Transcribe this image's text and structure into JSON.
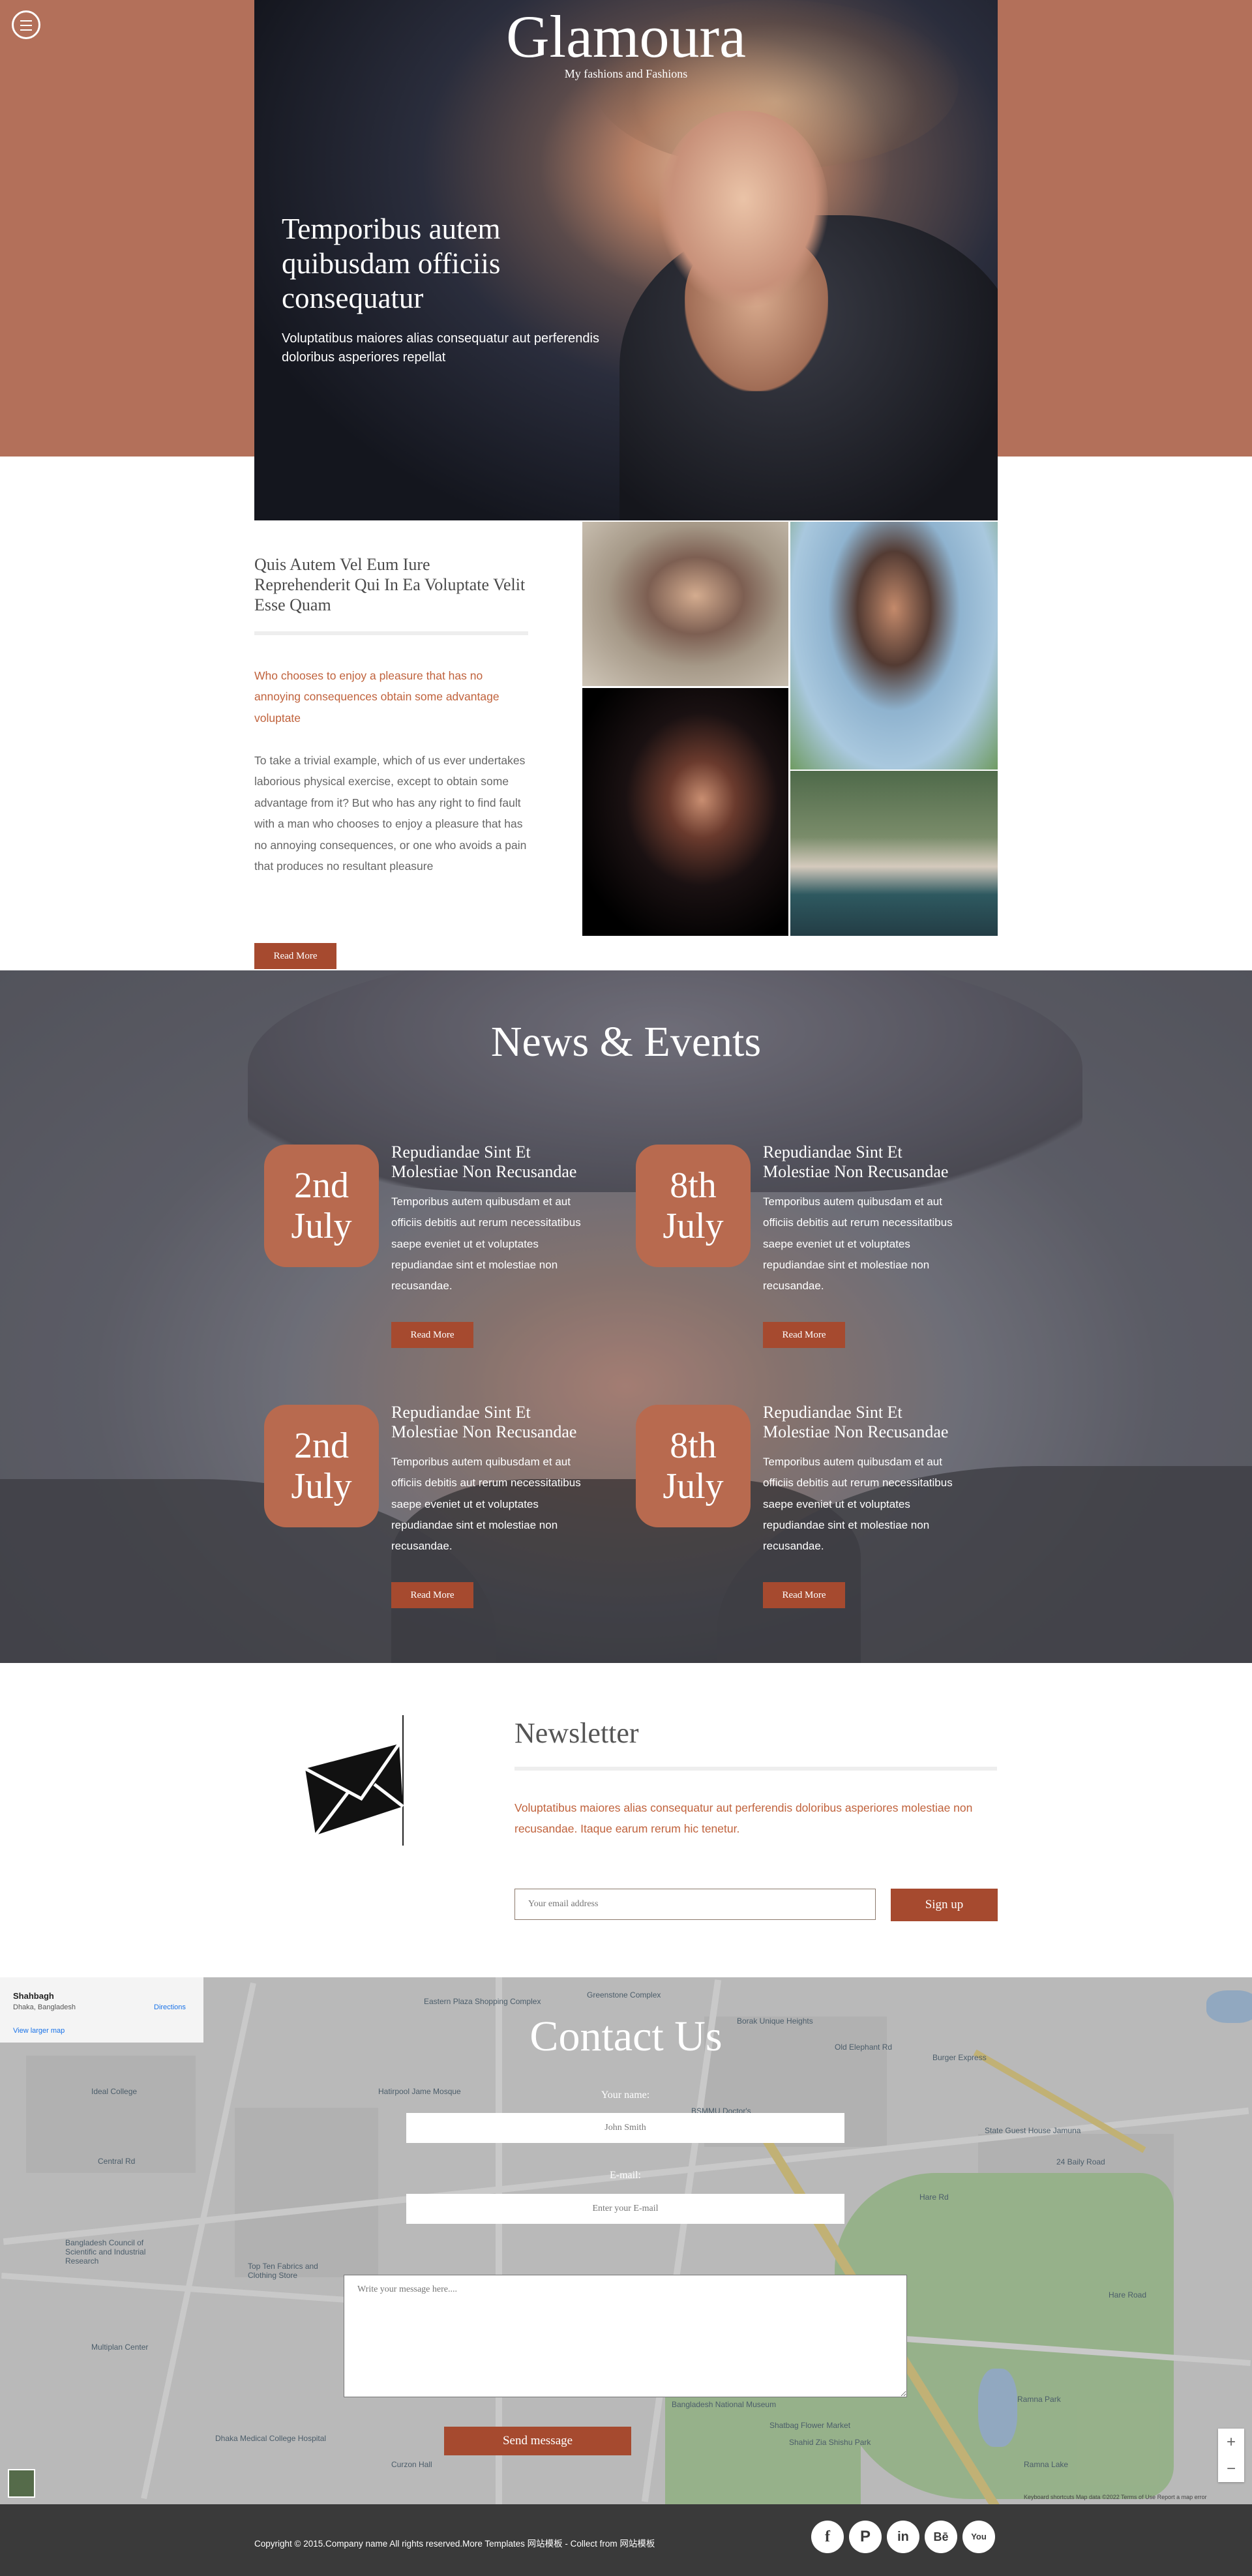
{
  "header": {
    "site_title": "Glamoura",
    "tagline": "My fashions and Fashions",
    "menu_icon": "menu-icon"
  },
  "hero": {
    "heading": "Temporibus autem quibusdam officiis consequatur",
    "text": "Voluptatibus maiores alias consequatur aut perferendis doloribus asperiores repellat"
  },
  "intro": {
    "title": "Quis Autem Vel Eum Iure Reprehenderit Qui In Ea Voluptate Velit Esse Quam",
    "accent": "Who chooses to enjoy a pleasure that has no annoying consequences obtain some advantage voluptate",
    "body": "To take a trivial example, which of us ever undertakes laborious physical exercise, except to obtain some advantage from it? But who has any right to find fault with a man who chooses to enjoy a pleasure that has no annoying consequences, or one who avoids a pain that produces no resultant pleasure",
    "read_more": "Read More"
  },
  "news": {
    "title": "News & Events",
    "events": [
      {
        "day": "2nd",
        "month": "July",
        "title": "Repudiandae Sint Et Molestiae Non Recusandae",
        "text": "Temporibus autem quibusdam et aut officiis debitis aut rerum necessitatibus saepe eveniet ut et voluptates repudiandae sint et molestiae non recusandae.",
        "read_more": "Read More"
      },
      {
        "day": "8th",
        "month": "July",
        "title": "Repudiandae Sint Et Molestiae Non Recusandae",
        "text": "Temporibus autem quibusdam et aut officiis debitis aut rerum necessitatibus saepe eveniet ut et voluptates repudiandae sint et molestiae non recusandae.",
        "read_more": "Read More"
      },
      {
        "day": "2nd",
        "month": "July",
        "title": "Repudiandae Sint Et Molestiae Non Recusandae",
        "text": "Temporibus autem quibusdam et aut officiis debitis aut rerum necessitatibus saepe eveniet ut et voluptates repudiandae sint et molestiae non recusandae.",
        "read_more": "Read More"
      },
      {
        "day": "8th",
        "month": "July",
        "title": "Repudiandae Sint Et Molestiae Non Recusandae",
        "text": "Temporibus autem quibusdam et aut officiis debitis aut rerum necessitatibus saepe eveniet ut et voluptates repudiandae sint et molestiae non recusandae.",
        "read_more": "Read More"
      }
    ]
  },
  "newsletter": {
    "title": "Newsletter",
    "text": "Voluptatibus maiores alias consequatur aut perferendis doloribus asperiores molestiae non recusandae. Itaque earum rerum hic tenetur.",
    "email_placeholder": "Your email address",
    "signup_label": "Sign up",
    "icon": "envelope-icon"
  },
  "map": {
    "place_name": "Shahbagh",
    "place_address": "Dhaka, Bangladesh",
    "directions_label": "Directions",
    "larger_map_link": "View larger map",
    "zoom_in": "+",
    "zoom_out": "−",
    "attribution": "Keyboard shortcuts   Map data ©2022   Terms of Use   Report a map error",
    "labels": [
      "Eastern Plaza Shopping Complex",
      "Greenstone Complex",
      "Borak Unique Heights",
      "Old Elephant Rd",
      "Burger Express",
      "Hatirpool Jame Mosque",
      "BSMMU Doctor's",
      "Ideal College",
      "Central Rd",
      "State Guest House Jamuna",
      "24 Baily Road",
      "Hare Rd",
      "Bangladesh Council of Scientific and Industrial Research",
      "Top Ten Fabrics and Clothing Store",
      "Multiplan Center",
      "Dhaka Medical College Hospital",
      "Ramna Park",
      "Shahid Zia Shishu Park",
      "Bangladesh National Museum",
      "Shatbag Flower Market",
      "Hare Road",
      "Ramna Lake",
      "Curzon Hall"
    ]
  },
  "contact": {
    "title": "Contact Us",
    "name_label": "Your name:",
    "name_value": "John Smith",
    "email_label": "E-mail:",
    "email_placeholder": "Enter your E-mail",
    "message_placeholder": "Write your message here....",
    "send_label": "Send message"
  },
  "footer": {
    "copyright": "Copyright © 2015.Company name All rights reserved.More Templates 网站模板 - Collect from 网站模板",
    "social": [
      {
        "name": "facebook-icon",
        "glyph": "f"
      },
      {
        "name": "pinterest-icon",
        "glyph": "P"
      },
      {
        "name": "linkedin-icon",
        "glyph": "in"
      },
      {
        "name": "behance-icon",
        "glyph": "Bē"
      },
      {
        "name": "youtube-icon",
        "glyph": "You"
      }
    ]
  },
  "colors": {
    "brand": "#b3705a",
    "button": "#a64a2f",
    "accent_text": "#c0623c",
    "footer": "#3a3a3a"
  }
}
